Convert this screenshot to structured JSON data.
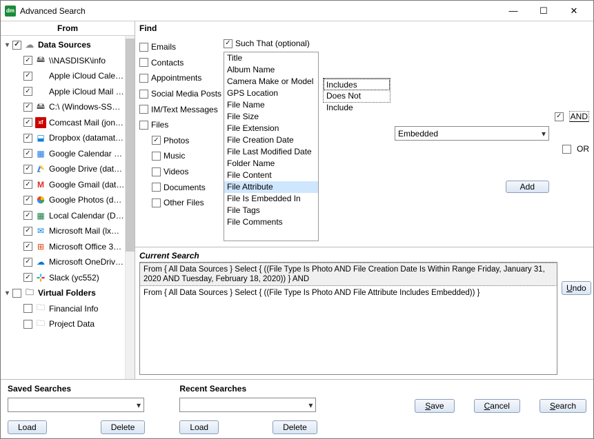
{
  "window": {
    "title": "Advanced Search"
  },
  "from": {
    "header": "From",
    "tree": [
      {
        "type": "group",
        "checked": true,
        "expanded": true,
        "label": "Data Sources",
        "icon": "cloud-icon",
        "iconClass": "i-cloud",
        "iconGlyph": "☁"
      },
      {
        "type": "item",
        "checked": true,
        "label": "\\\\NASDISK\\info",
        "icon": "disk-icon",
        "iconClass": "i-disk",
        "iconGlyph": "🖴"
      },
      {
        "type": "item",
        "checked": true,
        "label": "Apple iCloud Calen…",
        "icon": "apple-icon",
        "iconClass": "i-apple",
        "iconGlyph": ""
      },
      {
        "type": "item",
        "checked": true,
        "label": "Apple iCloud Mail (l…",
        "icon": "apple-icon",
        "iconClass": "i-apple",
        "iconGlyph": ""
      },
      {
        "type": "item",
        "checked": true,
        "label": "C:\\ (Windows-SSD…",
        "icon": "disk-icon",
        "iconClass": "i-disk",
        "iconGlyph": "🖴"
      },
      {
        "type": "item",
        "checked": true,
        "label": "Comcast Mail (jon…",
        "icon": "xfinity-icon",
        "iconClass": "i-xf",
        "iconGlyph": "xf"
      },
      {
        "type": "item",
        "checked": true,
        "label": "Dropbox (datamat…",
        "icon": "dropbox-icon",
        "iconClass": "i-dbx",
        "iconGlyph": "⬓"
      },
      {
        "type": "item",
        "checked": true,
        "label": "Google Calendar (…",
        "icon": "gcal-icon",
        "iconClass": "i-gcal",
        "iconGlyph": "▦"
      },
      {
        "type": "item",
        "checked": true,
        "label": "Google Drive (dat…",
        "icon": "gdrive-icon",
        "iconClass": "i-gdrive",
        "iconGlyph": "<svg width='14' height='14' viewBox='0 0 24 24'><path fill='#0f9d58' d='M3 20l3-5 6 5z'/><path fill='#ffcd40' d='M9 4h6l6 10h-6z'/><path fill='#4285f4' d='M3 20l6-16 3 5-6 11z'/></svg>"
      },
      {
        "type": "item",
        "checked": true,
        "label": "Google Gmail (dat…",
        "icon": "gmail-icon",
        "iconClass": "i-gmail",
        "iconGlyph": "M"
      },
      {
        "type": "item",
        "checked": true,
        "label": "Google Photos (da…",
        "icon": "gphotos-icon",
        "iconClass": "i-gphotos",
        "iconGlyph": "<svg width='14' height='14' viewBox='0 0 24 24'><path fill='#ea4335' d='M12 3v9H3a9 9 0 019-9z'/><path fill='#fbbc04' d='M21 12h-9V3a9 9 0 019 9z'/><path fill='#34a853' d='M12 21v-9h9a9 9 0 01-9 9z'/><path fill='#4285f4' d='M3 12h9v9a9 9 0 01-9-9z'/></svg>"
      },
      {
        "type": "item",
        "checked": true,
        "label": "Local Calendar (D…",
        "icon": "localcal-icon",
        "iconClass": "i-localcal",
        "iconGlyph": "▦"
      },
      {
        "type": "item",
        "checked": true,
        "label": "Microsoft Mail (lxm…",
        "icon": "msmail-icon",
        "iconClass": "i-msmail",
        "iconGlyph": "✉"
      },
      {
        "type": "item",
        "checked": true,
        "label": "Microsoft Office 3…",
        "icon": "office-icon",
        "iconClass": "i-office",
        "iconGlyph": "⊞"
      },
      {
        "type": "item",
        "checked": true,
        "label": "Microsoft OneDriv…",
        "icon": "onedrive-icon",
        "iconClass": "i-onedrive",
        "iconGlyph": "☁"
      },
      {
        "type": "item",
        "checked": true,
        "label": "Slack (yc552)",
        "icon": "slack-icon",
        "iconClass": "i-slack",
        "iconGlyph": "<svg width='14' height='14' viewBox='0 0 24 24'><rect x='10' y='2' width='4' height='8' rx='2' fill='#36c5f0'/><rect x='2' y='10' width='8' height='4' rx='2' fill='#2eb67d'/><rect x='10' y='14' width='4' height='8' rx='2' fill='#ecb22e'/><rect x='14' y='10' width='8' height='4' rx='2' fill='#e01e5a'/></svg>"
      },
      {
        "type": "group",
        "checked": false,
        "expanded": true,
        "label": "Virtual Folders",
        "icon": "folder-icon",
        "iconClass": "i-folder",
        "iconGlyph": "🗀"
      },
      {
        "type": "item",
        "checked": false,
        "label": "Financial Info",
        "icon": "folder-icon",
        "iconClass": "i-folder",
        "iconGlyph": "🗀"
      },
      {
        "type": "item",
        "checked": false,
        "label": "Project Data",
        "icon": "folder-icon",
        "iconClass": "i-folder",
        "iconGlyph": "🗀"
      }
    ]
  },
  "find": {
    "header": "Find",
    "such_that": {
      "checked": true,
      "label": "Such That  (optional)"
    },
    "types": [
      {
        "label": "Emails",
        "checked": false
      },
      {
        "label": "Contacts",
        "checked": false
      },
      {
        "label": "Appointments",
        "checked": false
      },
      {
        "label": "Social Media Posts",
        "checked": false
      },
      {
        "label": "IM/Text Messages",
        "checked": false
      },
      {
        "label": "Files",
        "checked": false,
        "children": [
          {
            "label": "Photos",
            "checked": true
          },
          {
            "label": "Music",
            "checked": false
          },
          {
            "label": "Videos",
            "checked": false
          },
          {
            "label": "Documents",
            "checked": false
          },
          {
            "label": "Other Files",
            "checked": false
          }
        ]
      }
    ],
    "attributes": [
      "Title",
      "Album Name",
      "Camera Make or Model",
      "GPS Location",
      "File Name",
      "File Size",
      "File Extension",
      "File Creation Date",
      "File Last Modified Date",
      "Folder Name",
      "File Content",
      "File Attribute",
      "File Is Embedded In",
      "File Tags",
      "File Comments"
    ],
    "attribute_selected_index": 11,
    "conditions": [
      "Includes",
      "Does Not Include"
    ],
    "condition_selected_index": 0,
    "value_selected": "Embedded",
    "bool_and_checked": true,
    "bool_and_label": "AND",
    "bool_or_checked": false,
    "bool_or_label": "OR",
    "add_button": "Add"
  },
  "current_search": {
    "header": "Current Search",
    "rows": [
      "From { All Data Sources } Select { ((File Type Is Photo AND File Creation Date Is Within Range Friday, January 31, 2020 AND Tuesday, February 18, 2020)) } AND",
      "From { All Data Sources } Select { ((File Type Is Photo AND File Attribute Includes Embedded)) }"
    ],
    "selected_index": 0,
    "undo": "Undo"
  },
  "bottom": {
    "saved_label": "Saved Searches",
    "recent_label": "Recent Searches",
    "load": "Load",
    "delete": "Delete",
    "save": "Save",
    "cancel": "Cancel",
    "search": "Search"
  }
}
